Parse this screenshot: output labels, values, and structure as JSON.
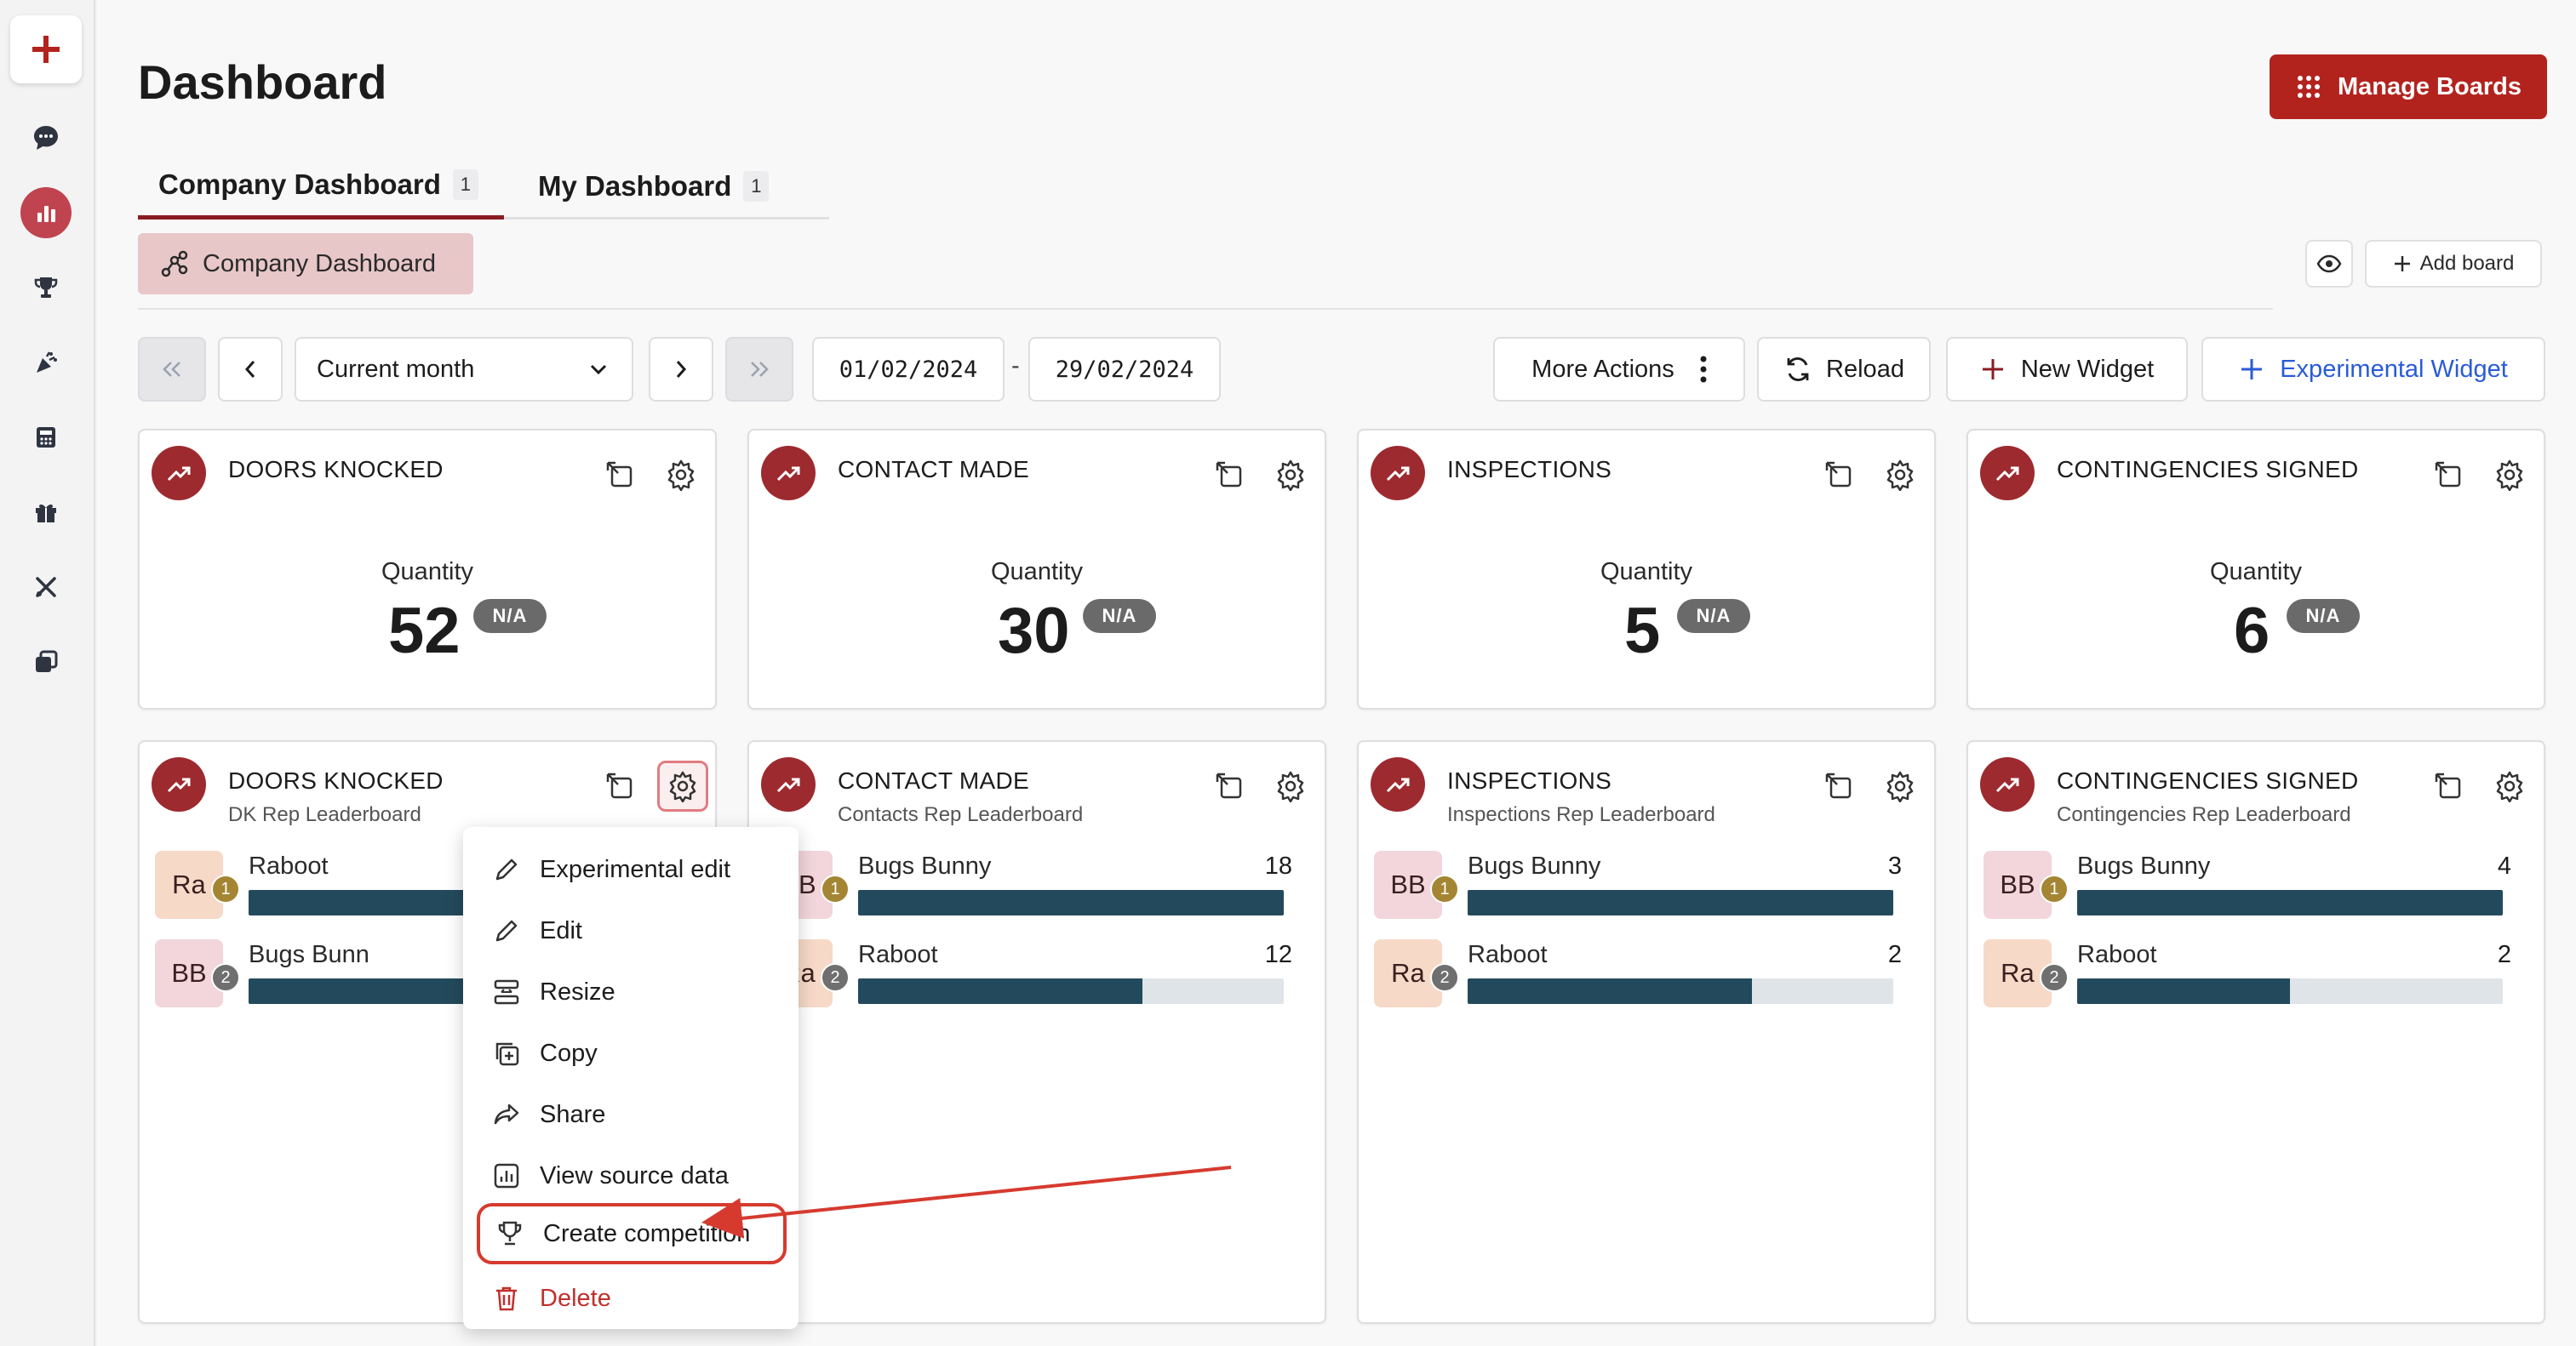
{
  "page": {
    "title": "Dashboard"
  },
  "header": {
    "manage_boards_label": "Manage Boards"
  },
  "tabs": [
    {
      "label": "Company Dashboard",
      "count": "1",
      "active": true
    },
    {
      "label": "My Dashboard",
      "count": "1",
      "active": false
    }
  ],
  "board_chip": {
    "label": "Company Dashboard"
  },
  "board_actions": {
    "add_board_label": "Add board"
  },
  "toolbar": {
    "period_select": "Current month",
    "date_from": "01/02/2024",
    "date_separator": "-",
    "date_to": "29/02/2024",
    "more_actions_label": "More Actions",
    "reload_label": "Reload",
    "new_widget_label": "New Widget",
    "experimental_widget_label": "Experimental Widget"
  },
  "colors": {
    "brand": "#b3231e",
    "accent_dark": "#8a1d22",
    "badge": "#9d2a2f",
    "bar": "#234a5c",
    "link_blue": "#2a5bd7",
    "highlight": "#d63a2f"
  },
  "kpi_cards": [
    {
      "title": "DOORS KNOCKED",
      "metric_label": "Quantity",
      "value": "52",
      "badge": "N/A"
    },
    {
      "title": "CONTACT MADE",
      "metric_label": "Quantity",
      "value": "30",
      "badge": "N/A"
    },
    {
      "title": "INSPECTIONS",
      "metric_label": "Quantity",
      "value": "5",
      "badge": "N/A"
    },
    {
      "title": "CONTINGENCIES SIGNED",
      "metric_label": "Quantity",
      "value": "6",
      "badge": "N/A"
    }
  ],
  "leaderboards": [
    {
      "title": "DOORS KNOCKED",
      "subtitle": "DK Rep Leaderboard",
      "rows": [
        {
          "initials": "Ra",
          "rank": "1",
          "name": "Raboot",
          "value": "",
          "fraction": 1.0
        },
        {
          "initials": "BB",
          "rank": "2",
          "name": "Bugs Bunn",
          "value": "",
          "fraction": 0.6
        }
      ]
    },
    {
      "title": "CONTACT MADE",
      "subtitle": "Contacts Rep Leaderboard",
      "rows": [
        {
          "initials": "BB",
          "rank": "1",
          "name": "Bugs Bunny",
          "value": "18",
          "fraction": 1.0
        },
        {
          "initials": "Ra",
          "rank": "2",
          "name": "Raboot",
          "value": "12",
          "fraction": 0.667
        }
      ]
    },
    {
      "title": "INSPECTIONS",
      "subtitle": "Inspections Rep Leaderboard",
      "rows": [
        {
          "initials": "BB",
          "rank": "1",
          "name": "Bugs Bunny",
          "value": "3",
          "fraction": 1.0
        },
        {
          "initials": "Ra",
          "rank": "2",
          "name": "Raboot",
          "value": "2",
          "fraction": 0.667
        }
      ]
    },
    {
      "title": "CONTINGENCIES SIGNED",
      "subtitle": "Contingencies Rep Leaderboard",
      "rows": [
        {
          "initials": "BB",
          "rank": "1",
          "name": "Bugs Bunny",
          "value": "4",
          "fraction": 1.0
        },
        {
          "initials": "Ra",
          "rank": "2",
          "name": "Raboot",
          "value": "2",
          "fraction": 0.5
        }
      ]
    }
  ],
  "context_menu": {
    "items": [
      {
        "label": "Experimental edit",
        "icon": "pencil-icon"
      },
      {
        "label": "Edit",
        "icon": "pencil-icon"
      },
      {
        "label": "Resize",
        "icon": "resize-icon"
      },
      {
        "label": "Copy",
        "icon": "copy-icon"
      },
      {
        "label": "Share",
        "icon": "share-icon"
      },
      {
        "label": "View source data",
        "icon": "chart-icon"
      },
      {
        "label": "Create competition",
        "icon": "trophy-icon",
        "highlighted": true
      },
      {
        "label": "Delete",
        "icon": "trash-icon",
        "danger": true
      }
    ]
  },
  "sidebar": {
    "items": [
      {
        "icon": "chat-icon"
      },
      {
        "icon": "bar-chart-icon",
        "active": true
      },
      {
        "icon": "trophy-icon"
      },
      {
        "icon": "celebration-icon"
      },
      {
        "icon": "calculator-icon"
      },
      {
        "icon": "gift-icon"
      },
      {
        "icon": "tools-icon"
      },
      {
        "icon": "layers-icon"
      }
    ]
  }
}
